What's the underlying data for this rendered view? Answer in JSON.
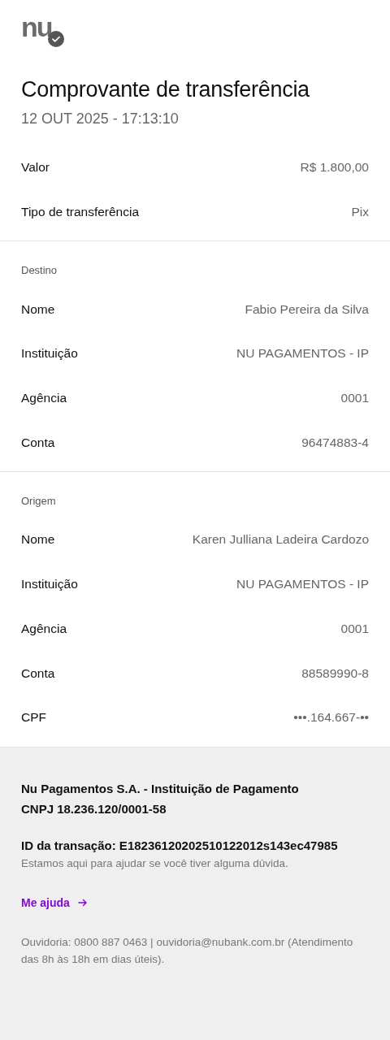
{
  "logo": {
    "text": "nu"
  },
  "title": "Comprovante de transferência",
  "datetime": "12 OUT 2025 - 17:13:10",
  "summary": [
    {
      "label": "Valor",
      "value": "R$ 1.800,00"
    },
    {
      "label": "Tipo de transferência",
      "value": "Pix"
    }
  ],
  "sections": [
    {
      "heading": "Destino",
      "rows": [
        {
          "label": "Nome",
          "value": "Fabio Pereira da Silva"
        },
        {
          "label": "Instituição",
          "value": "NU PAGAMENTOS - IP"
        },
        {
          "label": "Agência",
          "value": "0001"
        },
        {
          "label": "Conta",
          "value": "96474883-4"
        }
      ]
    },
    {
      "heading": "Origem",
      "rows": [
        {
          "label": "Nome",
          "value": "Karen Julliana Ladeira Cardozo"
        },
        {
          "label": "Instituição",
          "value": "NU PAGAMENTOS - IP"
        },
        {
          "label": "Agência",
          "value": "0001"
        },
        {
          "label": "Conta",
          "value": "88589990-8"
        },
        {
          "label": "CPF",
          "value": "•••.164.667-••"
        }
      ]
    }
  ],
  "footer": {
    "company": "Nu Pagamentos S.A. - Instituição de Pagamento",
    "cnpj": "CNPJ 18.236.120/0001-58",
    "transaction_id": "ID da transação: E18236120202510122012s143ec47985",
    "help_text": "Estamos aqui para ajudar se você tiver alguma dúvida.",
    "help_link": "Me ajuda",
    "ombudsman": "Ouvidoria: 0800 887 0463 | ouvidoria@nubank.com.br (Atendimento das 8h às 18h em dias úteis)."
  }
}
